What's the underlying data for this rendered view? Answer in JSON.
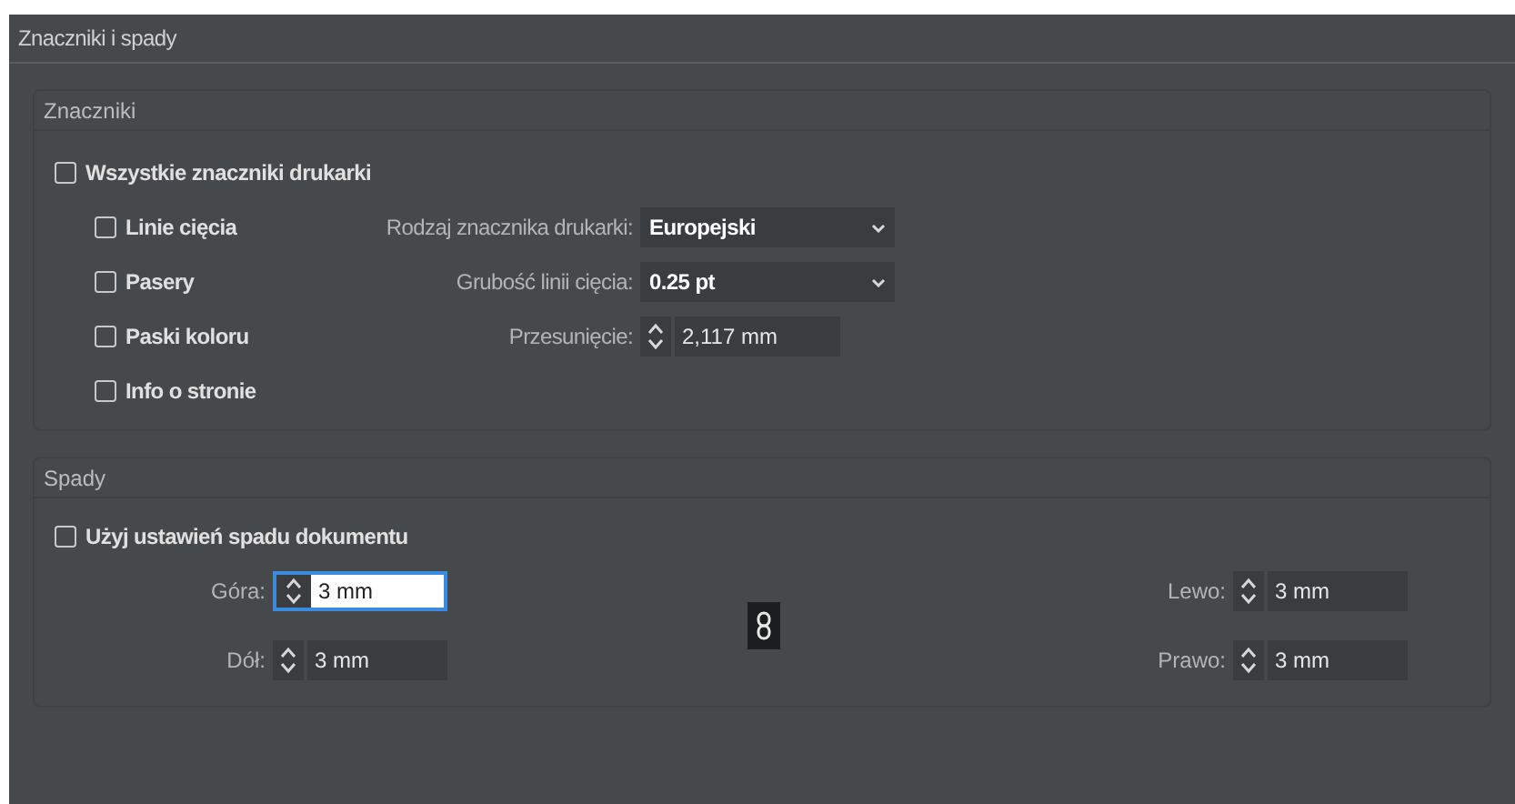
{
  "panel": {
    "title": "Znaczniki i spady"
  },
  "marks": {
    "title": "Znaczniki",
    "all": {
      "label": "Wszystkie znaczniki drukarki",
      "checked": false
    },
    "options": [
      {
        "label": "Linie cięcia",
        "checked": false
      },
      {
        "label": "Pasery",
        "checked": false
      },
      {
        "label": "Paski koloru",
        "checked": false
      },
      {
        "label": "Info o stronie",
        "checked": false
      }
    ],
    "fields": [
      {
        "kind": "dropdown",
        "label": "Rodzaj znacznika drukarki:",
        "value": "Europejski"
      },
      {
        "kind": "dropdown",
        "label": "Grubość linii cięcia:",
        "value": "0.25 pt"
      },
      {
        "kind": "spinner",
        "label": "Przesunięcie:",
        "value": "2,117 mm"
      }
    ]
  },
  "bleed": {
    "title": "Spady",
    "use_document": {
      "label": "Użyj ustawień spadu dokumentu",
      "checked": false
    },
    "left_fields": [
      {
        "label": "Góra:",
        "value": "3 mm",
        "focused": true
      },
      {
        "label": "Dół:",
        "value": "3 mm",
        "focused": false
      }
    ],
    "right_fields": [
      {
        "label": "Lewo:",
        "value": "3 mm",
        "focused": false
      },
      {
        "label": "Prawo:",
        "value": "3 mm",
        "focused": false
      }
    ]
  }
}
